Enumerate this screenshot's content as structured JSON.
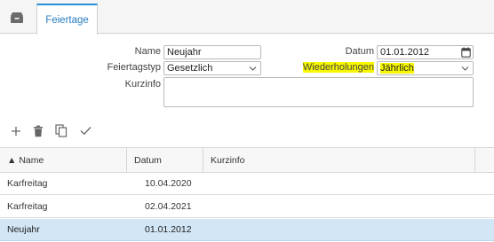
{
  "tabs": {
    "home_icon": "box-icon",
    "active_tab_label": "Feiertage",
    "accent_color": "#2a8fd8"
  },
  "form": {
    "name_label": "Name",
    "name_value": "Neujahr",
    "type_label": "Feiertagstyp",
    "type_value": "Gesetzlich",
    "kurzinfo_label": "Kurzinfo",
    "kurzinfo_value": "",
    "datum_label": "Datum",
    "datum_value": "01.01.2012",
    "wiederholungen_label": "Wiederholungen",
    "wiederholungen_value": "Jährlich",
    "highlight_color": "#f7f700"
  },
  "toolbar": {
    "icons": [
      "plus-icon",
      "trash-icon",
      "copy-icon",
      "check-icon"
    ]
  },
  "grid": {
    "sort_indicator": "▲",
    "columns": [
      "Name",
      "Datum",
      "Kurzinfo"
    ],
    "rows": [
      {
        "name": "Karfreitag",
        "datum": "10.04.2020",
        "kurzinfo": ""
      },
      {
        "name": "Karfreitag",
        "datum": "02.04.2021",
        "kurzinfo": ""
      },
      {
        "name": "Neujahr",
        "datum": "01.01.2012",
        "kurzinfo": ""
      }
    ],
    "selected_row": 2,
    "selected_color": "#d2e6f6"
  }
}
